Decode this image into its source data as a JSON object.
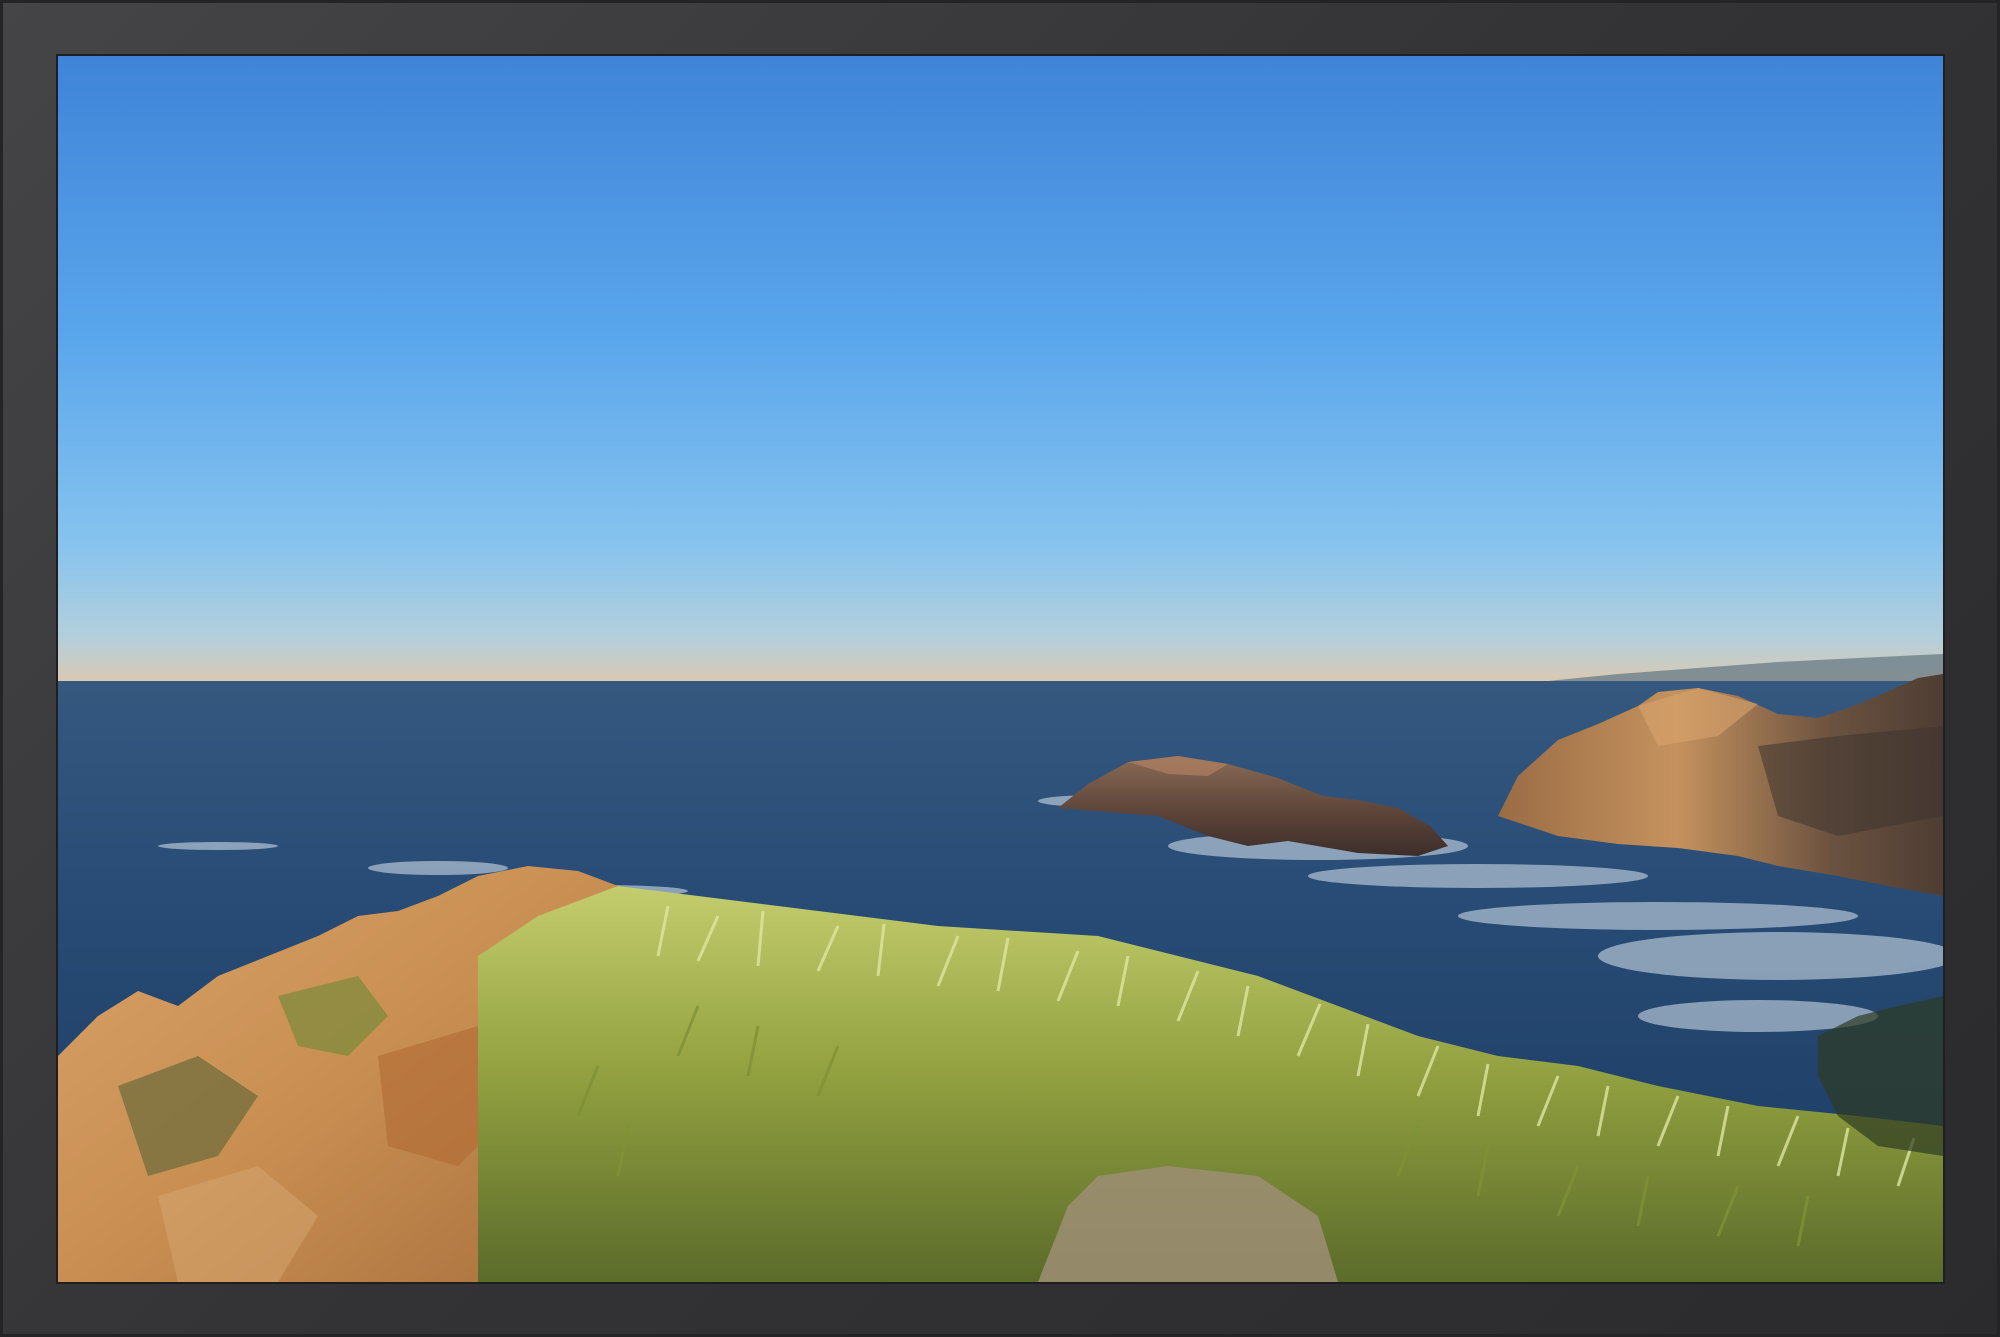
{
  "scene": {
    "subject": "coastal-seascape",
    "frame_color": "#3a3a3c",
    "colors": {
      "sky_top": "#3f84d8",
      "sky_mid": "#5fa9ec",
      "sky_horizon": "#a9c9dd",
      "horizon_haze": "#d9c9b4",
      "sea_far": "#2d4f7a",
      "sea_near": "#1c3c63",
      "surf": "#dbe7f0",
      "rock_lit": "#c98f52",
      "rock_shadow": "#4a3a32",
      "grass": "#a4b24a",
      "grass_light": "#dfe6a2"
    }
  }
}
